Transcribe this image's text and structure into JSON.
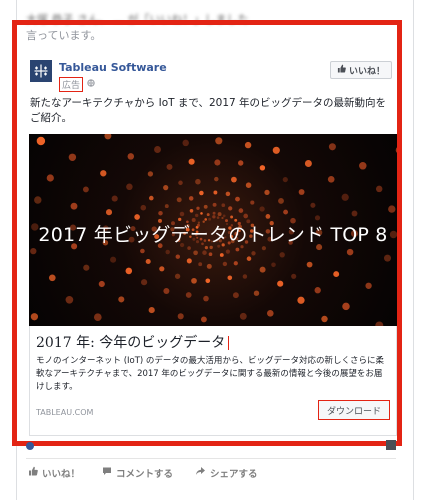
{
  "top_text": {
    "line1": "大塚 恭子 さん、 ... が「いいね！」しました",
    "line2": "言っています。"
  },
  "post": {
    "page_name": "Tableau Software",
    "ad_label": "広告",
    "like_page_label": "いいね！",
    "text": "新たなアーキテクチャから IoT まで、2017 年のビッグデータの最新動向をご紹介。"
  },
  "media": {
    "headline": "2017 年ビッグデータのトレンド TOP 8"
  },
  "link": {
    "title": "2017 年: 今年のビッグデータ",
    "description": "モノのインターネット (IoT) のデータの最大活用から、ビッグデータ対応の新しくさらに柔軟なアーキテクチャまで、2017 年のビッグデータに関する最新の情報と今後の展望をお届けします。",
    "domain": "TABLEAU.COM",
    "cta_label": "ダウンロード"
  },
  "actions": {
    "like": "いいね！",
    "comment": "コメントする",
    "share": "シェアする"
  },
  "colors": {
    "highlight_frame": "#e32414",
    "brand_link": "#365899",
    "logo_bg": "#2a4471"
  },
  "icons": [
    "tableau-logo-icon",
    "globe-icon",
    "thumbs-up-icon",
    "comment-icon",
    "share-icon"
  ]
}
